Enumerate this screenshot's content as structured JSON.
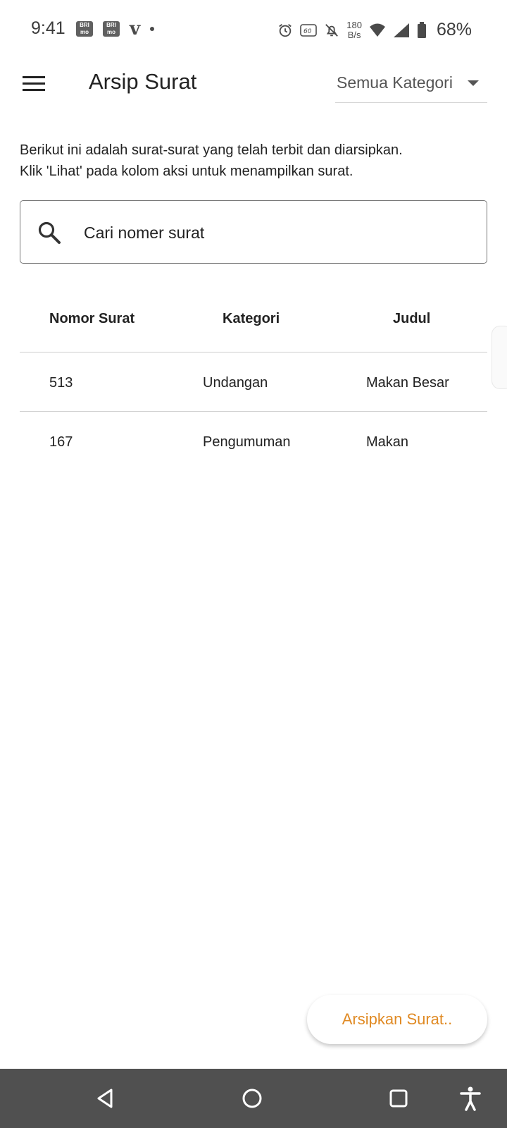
{
  "status_bar": {
    "time": "9:41",
    "notification_icons": [
      "BRI\nmo",
      "BRI\nmo"
    ],
    "net_speed_value": "180",
    "net_speed_unit": "B/s",
    "battery": "68%"
  },
  "app_bar": {
    "title": "Arsip Surat",
    "category_filter": "Semua Kategori"
  },
  "description": {
    "line1": "Berikut ini adalah surat-surat yang telah terbit dan diarsipkan.",
    "line2": "Klik 'Lihat' pada kolom aksi untuk menampilkan surat."
  },
  "search": {
    "placeholder": "Cari nomer surat",
    "value": ""
  },
  "table": {
    "headers": [
      "Nomor Surat",
      "Kategori",
      "Judul"
    ],
    "rows": [
      [
        "513",
        "Undangan",
        "Makan Besar"
      ],
      [
        "167",
        "Pengumuman",
        "Makan"
      ]
    ]
  },
  "fab": {
    "label": "Arsipkan Surat..",
    "color": "#e08a24"
  },
  "colors": {
    "nav_bar": "#505050",
    "text": "#222222"
  }
}
